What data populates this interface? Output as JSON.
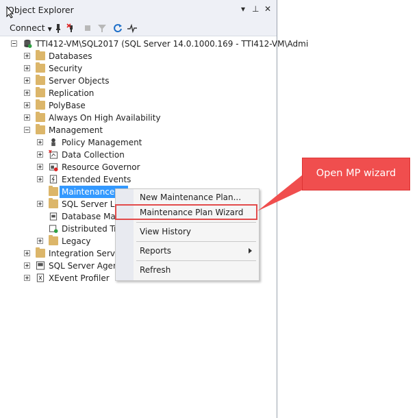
{
  "panel": {
    "title": "Object Explorer",
    "title_buttons": [
      "▾",
      "⊥",
      "✕"
    ]
  },
  "toolbar": {
    "connect_label": "Connect",
    "icons": [
      "connect-icon",
      "disconnect-icon",
      "stop-icon",
      "filter-icon",
      "refresh-icon",
      "activity-monitor-icon"
    ]
  },
  "tree": {
    "server": "TTI412-VM\\SQL2017 (SQL Server 14.0.1000.169 - TTI412-VM\\Admi",
    "nodes": {
      "databases": "Databases",
      "security": "Security",
      "server_objects": "Server Objects",
      "replication": "Replication",
      "polybase": "PolyBase",
      "always_on": "Always On High Availability",
      "management": "Management",
      "policy_management": "Policy Management",
      "data_collection": "Data Collection",
      "resource_governor": "Resource Governor",
      "extended_events": "Extended Events",
      "maintenance_plans": "Maintenance P",
      "sql_server_logs": "SQL Server Log",
      "database_mail": "Database Mail",
      "distributed_tr": "Distributed Tra",
      "legacy": "Legacy",
      "integration_services": "Integration Service",
      "sql_server_agent": "SQL Server Agent",
      "xevent_profiler": "XEvent Profiler"
    }
  },
  "context_menu": {
    "items": {
      "new_plan": "New Maintenance Plan...",
      "wizard": "Maintenance Plan Wizard",
      "view_history": "View History",
      "reports": "Reports",
      "refresh": "Refresh"
    }
  },
  "callout": {
    "text": "Open MP wizard"
  },
  "colors": {
    "accent_selected": "#3399ff",
    "highlight": "#e24a4a",
    "callout_bg": "#f04e4e"
  }
}
